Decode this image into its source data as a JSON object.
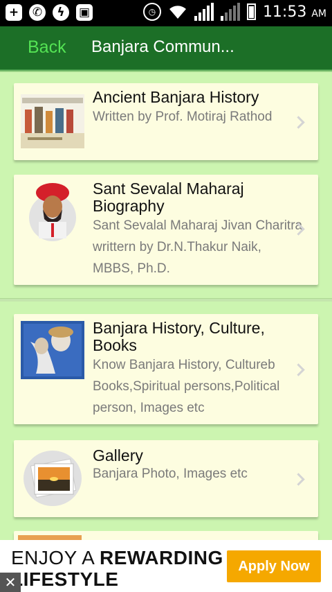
{
  "status_bar": {
    "time": "11:53",
    "ampm": "AM"
  },
  "header": {
    "back_label": "Back",
    "title": "Banjara Commun..."
  },
  "cards": [
    {
      "title": "Ancient Banjara History",
      "description": "Written by Prof. Motiraj Rathod"
    },
    {
      "title": "Sant Sevalal Maharaj Biography",
      "description": "Sant Sevalal Maharaj Jivan Charitra writtern by Dr.N.Thakur Naik, MBBS, Ph.D."
    },
    {
      "title": "Banjara History, Culture, Books",
      "description": "Know Banjara History, Cultureb Books,Spiritual persons,Political person, Images etc"
    },
    {
      "title": "Gallery",
      "description": "Banjara Photo, Images etc"
    }
  ],
  "ad": {
    "line1_a": "ENJOY A ",
    "line1_b": "REWARDING",
    "line2": "LIFESTYLE",
    "button_label": "Apply Now",
    "close_glyph": "✕"
  }
}
